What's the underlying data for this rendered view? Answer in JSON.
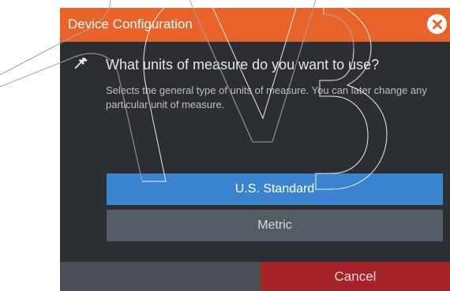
{
  "dialog": {
    "title": "Device Configuration",
    "question": "What units of measure do you want to use?",
    "description": "Selects the general type of units of measure. You can later change any particular unit of measure."
  },
  "options": [
    {
      "label": "U.S. Standard",
      "selected": true
    },
    {
      "label": "Metric",
      "selected": false
    }
  ],
  "footer": {
    "cancel_label": "Cancel"
  },
  "icons": {
    "close": "close-icon",
    "wrench": "wrench-icon"
  },
  "colors": {
    "title_bar": "#e8632a",
    "selected_option": "#3b82cf",
    "cancel": "#a6232a",
    "background": "#2b2e33"
  }
}
